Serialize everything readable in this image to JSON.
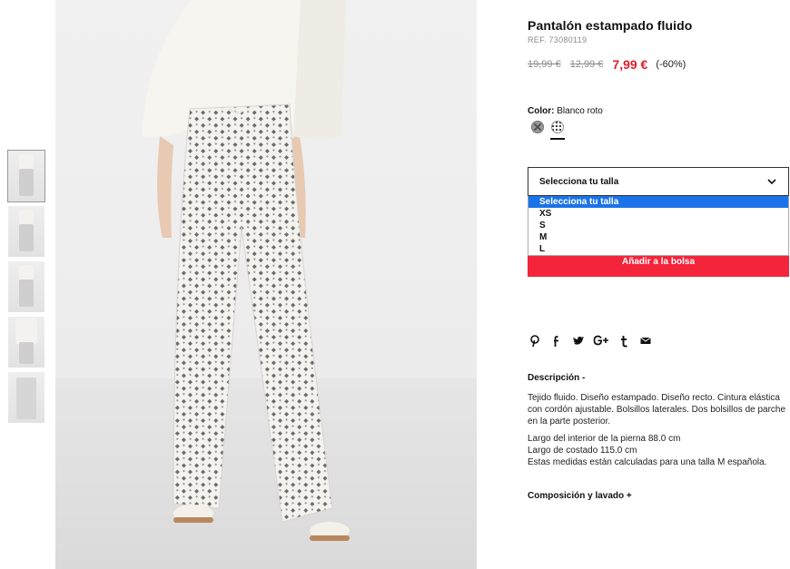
{
  "product": {
    "title": "Pantalón estampado fluido",
    "ref": "REF. 73080119",
    "prices": {
      "original": "19,99 €",
      "previous": "12,99 €",
      "current": "7,99 €",
      "discount": "(-60%)"
    },
    "accent_color": "#e01f2c"
  },
  "color": {
    "label": "Color:",
    "value": "Blanco roto"
  },
  "size": {
    "placeholder": "Selecciona tu talla",
    "options": [
      "Selecciona tu talla",
      "XS",
      "S",
      "M",
      "L"
    ],
    "highlighted": "Selecciona tu talla"
  },
  "cta": {
    "add_to_bag": "Añadir a la bolsa",
    "color": "#f4243b"
  },
  "share_icons": [
    "pinterest-icon",
    "facebook-icon",
    "twitter-icon",
    "google-plus-icon",
    "tumblr-icon",
    "email-icon"
  ],
  "description": {
    "title": "Descripción  -",
    "paragraph1": "Tejido fluido. Diseño estampado. Diseño recto. Cintura elástica con cordón ajustable. Bolsillos laterales. Dos bolsillos de parche en la parte posterior.",
    "measure1": "Largo del interior de la pierna 88.0 cm",
    "measure2": "Largo de costado 115.0 cm",
    "measure3": "Estas medidas están calculadas para una talla M española."
  },
  "composition": {
    "title": "Composición y lavado  +"
  }
}
